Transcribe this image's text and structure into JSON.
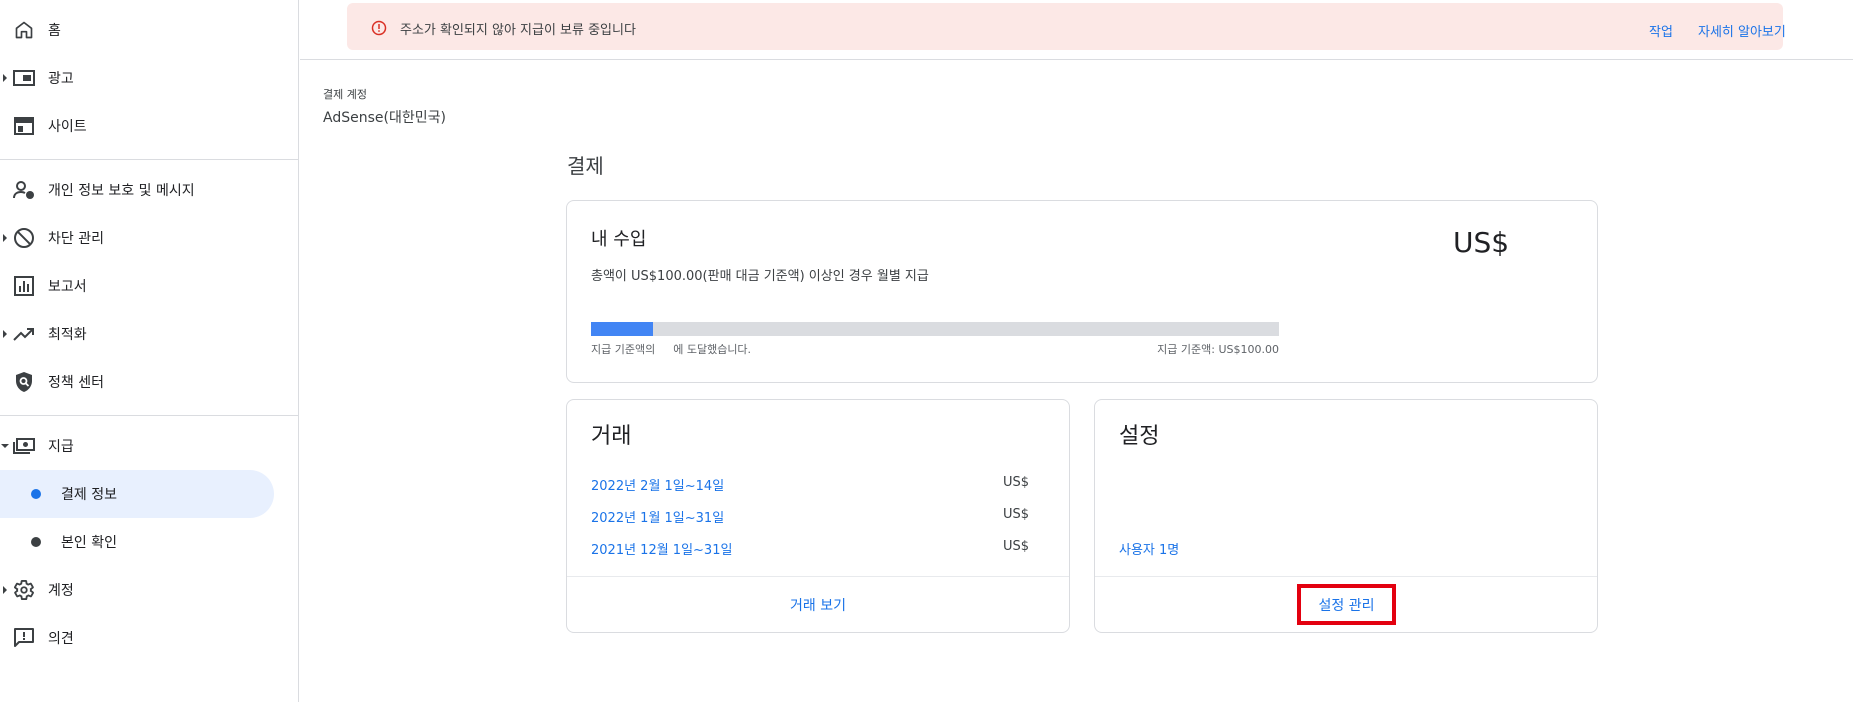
{
  "sidebar": {
    "items": [
      {
        "label": "홈",
        "icon": "home-icon",
        "caret": false
      },
      {
        "label": "광고",
        "icon": "ads-icon",
        "caret": true
      },
      {
        "label": "사이트",
        "icon": "sites-icon",
        "caret": false
      },
      {
        "label": "개인 정보 보호 및 메시지",
        "icon": "privacy-messaging-icon",
        "caret": false
      },
      {
        "label": "차단 관리",
        "icon": "block-icon",
        "caret": true
      },
      {
        "label": "보고서",
        "icon": "reports-icon",
        "caret": false
      },
      {
        "label": "최적화",
        "icon": "trending-up-icon",
        "caret": true
      },
      {
        "label": "정책 센터",
        "icon": "policy-shield-icon",
        "caret": false
      },
      {
        "label": "지급",
        "icon": "payments-icon",
        "caret": true,
        "expanded": true
      },
      {
        "label": "계정",
        "icon": "gear-icon",
        "caret": true
      },
      {
        "label": "의견",
        "icon": "feedback-icon",
        "caret": false
      }
    ],
    "payments_sub": [
      {
        "label": "결제 정보",
        "active": true
      },
      {
        "label": "본인 확인",
        "active": false
      }
    ]
  },
  "alert": {
    "message": "주소가 확인되지 않아 지급이 보류 중입니다",
    "action_label": "작업",
    "learn_more_label": "자세히 알아보기",
    "icon": "error-icon"
  },
  "account": {
    "caption": "결제 계정",
    "name": "AdSense(대한민국)"
  },
  "page_title": "결제",
  "earnings": {
    "title": "내 수입",
    "currency": "US$",
    "threshold_desc": "총액이 US$100.00(판매 대금 기준액) 이상인 경우 월별 지급",
    "progress_fraction": 0.09,
    "progress_left_a": "지급 기준액의",
    "progress_left_b": "에 도달했습니다.",
    "progress_right": "지급 기준액: US$100.00"
  },
  "transactions": {
    "title": "거래",
    "rows": [
      {
        "period": "2022년 2월 1일~14일",
        "amount": "US$"
      },
      {
        "period": "2022년 1월 1일~31일",
        "amount": "US$"
      },
      {
        "period": "2021년 12월 1일~31일",
        "amount": "US$"
      }
    ],
    "footer_label": "거래 보기"
  },
  "settings": {
    "title": "설정",
    "users_label": "사용자 1명",
    "footer_label": "설정 관리"
  },
  "colors": {
    "link": "#1a73e8",
    "alert_bg": "#fce8e6",
    "alert_icon": "#d93025",
    "progress_fill": "#4285f4",
    "highlight": "#e3000f",
    "active_nav_bg": "#e8f0fe"
  }
}
